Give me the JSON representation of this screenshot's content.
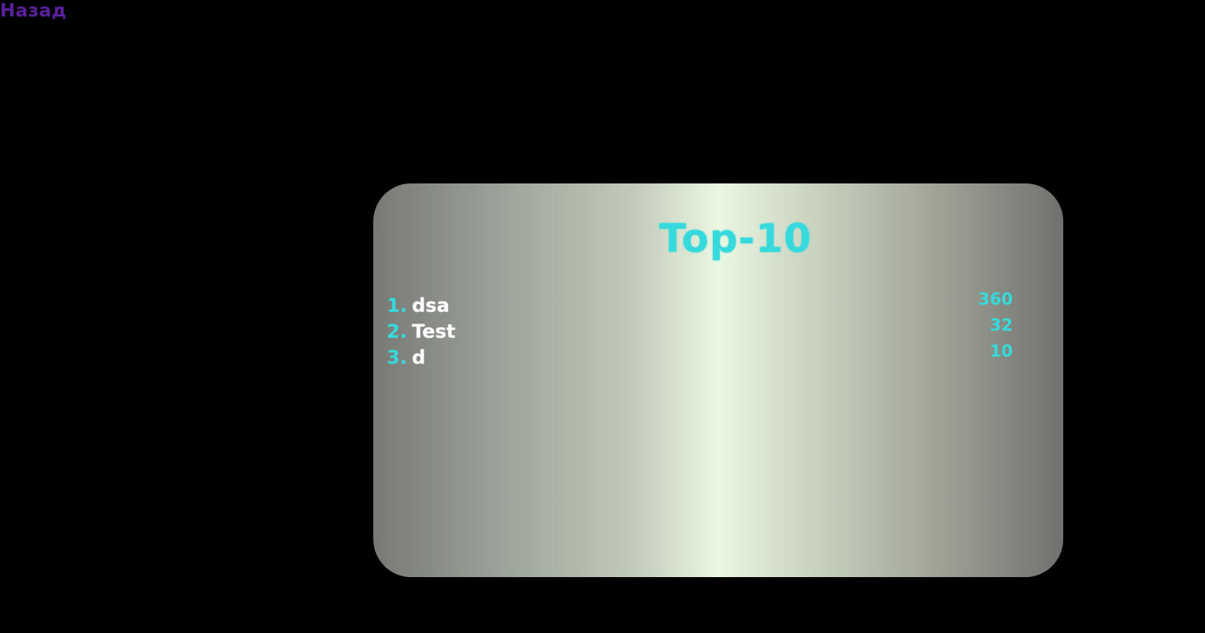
{
  "nav": {
    "back_label": "Назад"
  },
  "leaderboard": {
    "title": "Top-10",
    "entries": [
      {
        "rank": "1.",
        "name": "dsa",
        "score": "360"
      },
      {
        "rank": "2.",
        "name": "Test",
        "score": "32"
      },
      {
        "rank": "3.",
        "name": "d",
        "score": "10"
      }
    ]
  },
  "colors": {
    "background": "#000000",
    "back_link": "#5a1f9a",
    "accent": "#36d9dc",
    "player_name": "#ffffff"
  }
}
